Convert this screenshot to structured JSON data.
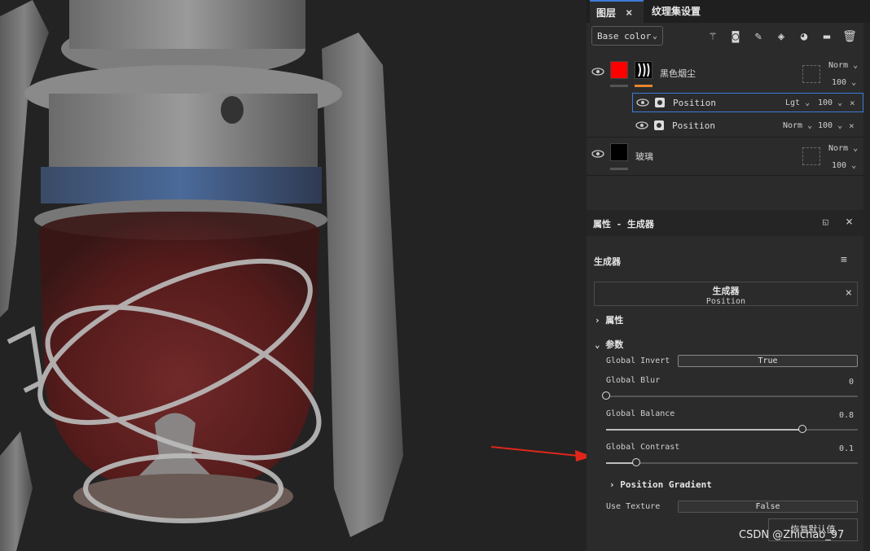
{
  "tabs": {
    "layers": "图层",
    "texture_set": "纹理集设置"
  },
  "toolbar": {
    "channel_select": "Base color"
  },
  "layers": [
    {
      "name": "黑色烟尘",
      "blend": "Norm",
      "opacity": "100",
      "thumb_color": "#ff0000"
    },
    {
      "name": "玻璃",
      "blend": "Norm",
      "opacity": "100",
      "thumb_color": "#000000"
    }
  ],
  "effects": [
    {
      "name": "Position",
      "blend": "Lgt",
      "opacity": "100",
      "selected": true
    },
    {
      "name": "Position",
      "blend": "Norm",
      "opacity": "100",
      "selected": false
    }
  ],
  "properties": {
    "title": "属性 - 生成器",
    "section": "生成器",
    "generator_title": "生成器",
    "generator_sub": "Position",
    "group_attributes": "属性",
    "group_params": "参数"
  },
  "params": {
    "global_invert": {
      "label": "Global Invert",
      "value": "True"
    },
    "global_blur": {
      "label": "Global Blur",
      "value": "0",
      "fraction": 0.0
    },
    "global_balance": {
      "label": "Global Balance",
      "value": "0.8",
      "fraction": 0.78
    },
    "global_contrast": {
      "label": "Global Contrast",
      "value": "0.1",
      "fraction": 0.12
    },
    "position_gradient": "Position Gradient",
    "use_texture": {
      "label": "Use Texture",
      "value": "False"
    },
    "reset": "恢复默认值"
  },
  "watermark": "CSDN @Zhichao_97",
  "colors": {
    "accent": "#3d7bd8",
    "arrow": "#e0261b",
    "layer_bar": "#e8862c"
  }
}
